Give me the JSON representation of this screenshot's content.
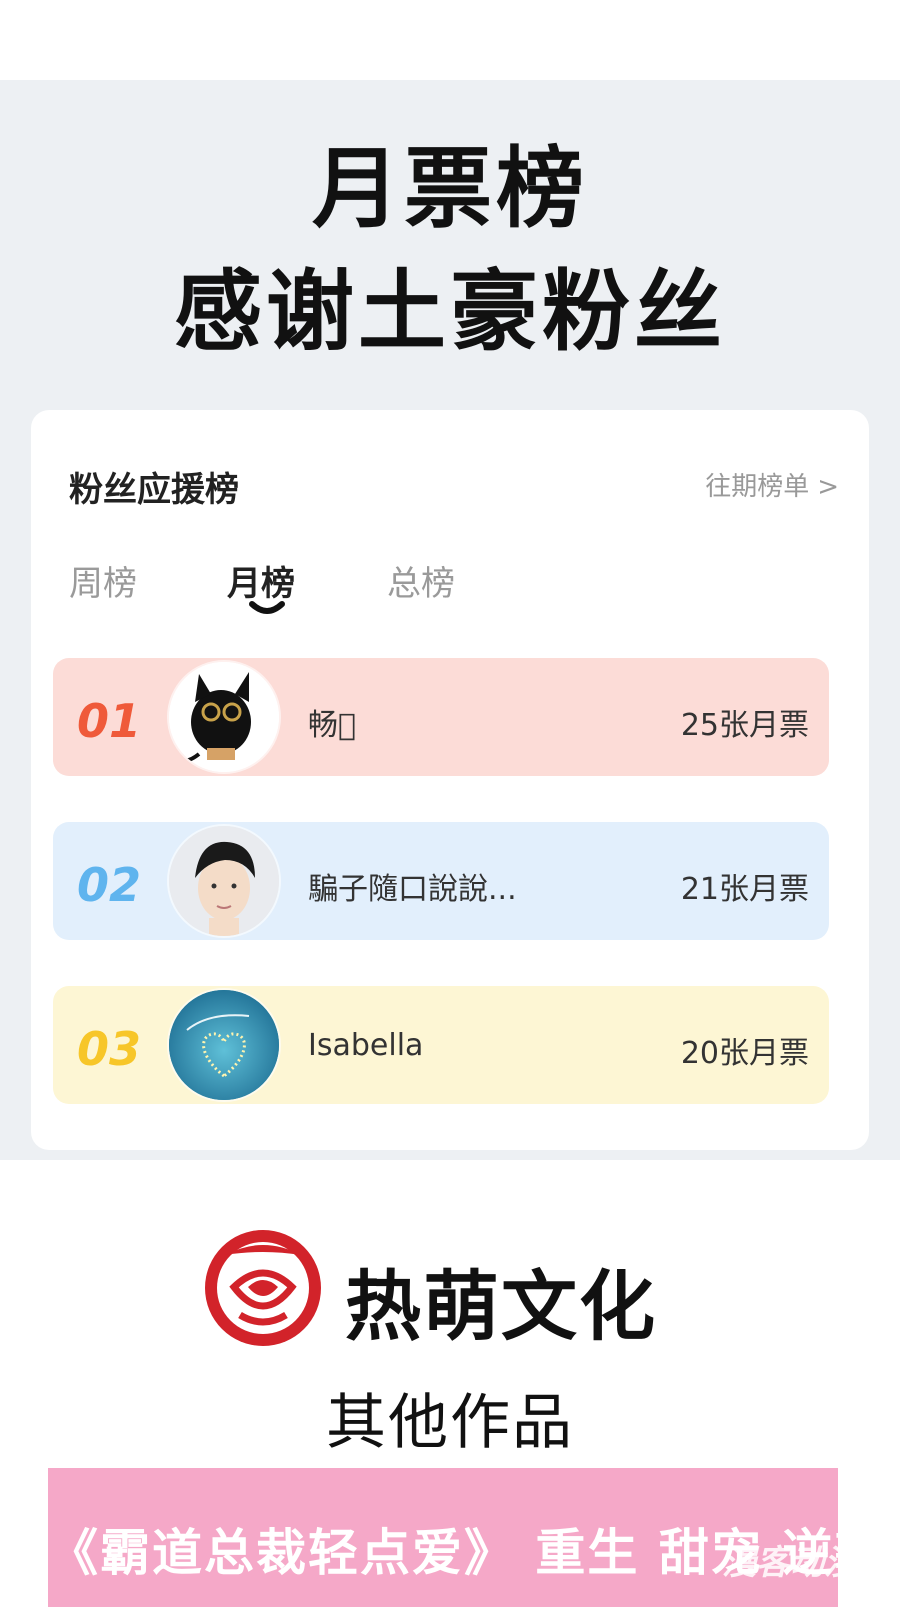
{
  "header": {
    "line1": "月票榜",
    "line2": "感谢土豪粉丝"
  },
  "card": {
    "title": "粉丝应援榜",
    "history_link": "往期榜单",
    "tabs": [
      {
        "label": "周榜",
        "active": false
      },
      {
        "label": "月榜",
        "active": true
      },
      {
        "label": "总榜",
        "active": false
      }
    ],
    "ranks": [
      {
        "rank": "01",
        "name": "畅\u0000",
        "votes": "25张月票",
        "rank_color": "#ef5a3a",
        "row_bg": "#fcdcd7"
      },
      {
        "rank": "02",
        "name": "騙子隨口說說...",
        "votes": "21张月票",
        "rank_color": "#5fb4ee",
        "row_bg": "#e2effc"
      },
      {
        "rank": "03",
        "name": "Isabella",
        "votes": "20张月票",
        "rank_color": "#f7c629",
        "row_bg": "#fdf6d4"
      }
    ]
  },
  "brand": {
    "name": "热萌文化",
    "logo_color": "#d2232a"
  },
  "other_works": "其他作品",
  "banner": {
    "text": "《霸道总裁轻点爱》 重生 甜宠 逆袭",
    "bg": "#f5a8c8"
  },
  "watermark": "漫客动漫"
}
